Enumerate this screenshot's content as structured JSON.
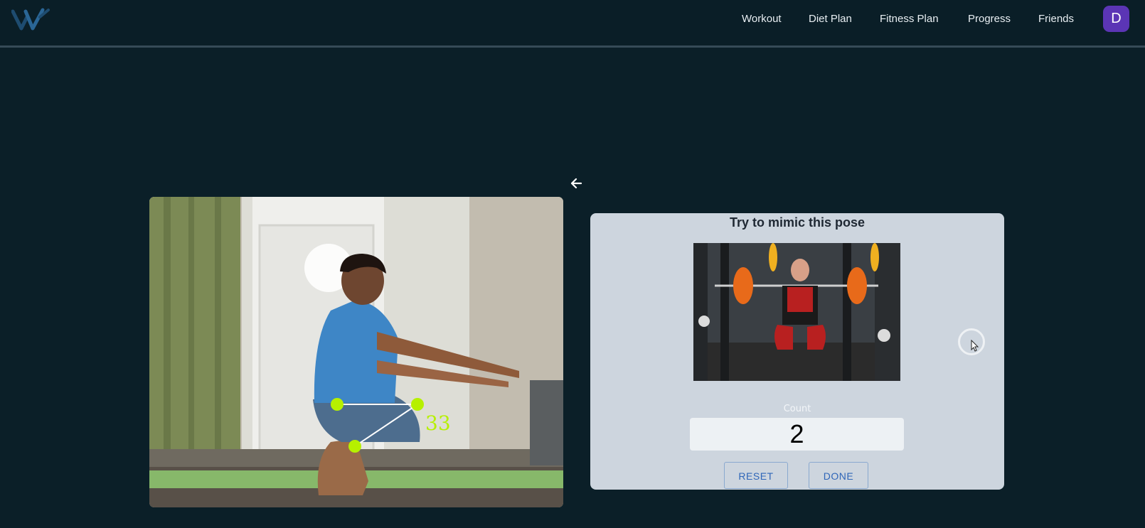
{
  "nav": {
    "items": [
      {
        "label": "Workout"
      },
      {
        "label": "Diet Plan"
      },
      {
        "label": "Fitness Plan"
      },
      {
        "label": "Progress"
      },
      {
        "label": "Friends"
      }
    ],
    "avatar_initial": "D"
  },
  "camera": {
    "angle_label": "33"
  },
  "panel": {
    "title": "Try to mimic this pose",
    "count_label": "Count",
    "count_value": "2",
    "reset_label": "RESET",
    "done_label": "DONE"
  },
  "colors": {
    "background": "#0b1f28",
    "navbar": "#0a1e27",
    "panel": "#cdd5de",
    "avatar": "#5b35b5",
    "keypoint": "#b6f000",
    "button_text": "#2f66b8"
  },
  "icons": {
    "logo": "logo-icon",
    "back": "arrow-left-icon",
    "loader": "spinner-icon",
    "cursor": "mouse-cursor-icon"
  }
}
